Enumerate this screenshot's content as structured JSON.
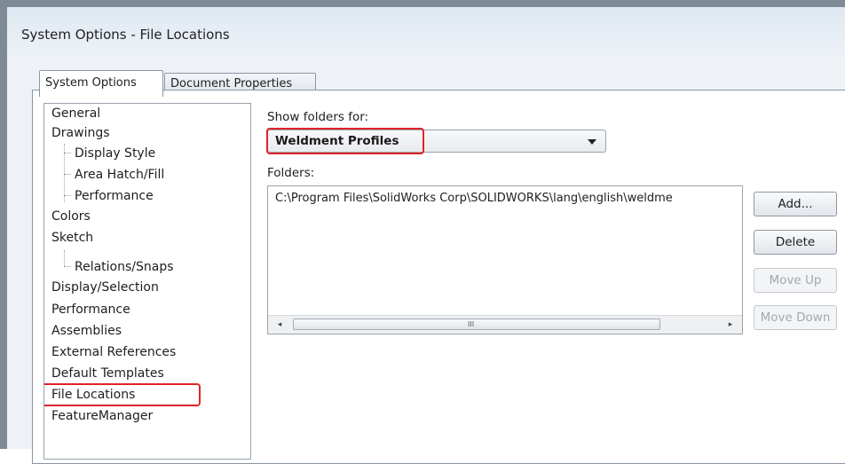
{
  "window": {
    "title": "System Options - File Locations"
  },
  "tabs": [
    {
      "label": "System Options",
      "active": true
    },
    {
      "label": "Document Properties",
      "active": false
    }
  ],
  "tree": {
    "items": [
      {
        "label": "General",
        "indent": 0
      },
      {
        "label": "Drawings",
        "indent": 0
      },
      {
        "label": "Display Style",
        "indent": 1
      },
      {
        "label": "Area Hatch/Fill",
        "indent": 1
      },
      {
        "label": "Performance",
        "indent": 1
      },
      {
        "label": "Colors",
        "indent": 0
      },
      {
        "label": "Sketch",
        "indent": 0
      },
      {
        "label": "Relations/Snaps",
        "indent": 1
      },
      {
        "label": "Display/Selection",
        "indent": 0
      },
      {
        "label": "Performance",
        "indent": 0
      },
      {
        "label": "Assemblies",
        "indent": 0
      },
      {
        "label": "External References",
        "indent": 0
      },
      {
        "label": "Default Templates",
        "indent": 0
      },
      {
        "label": "File Locations",
        "indent": 0,
        "selected": true
      },
      {
        "label": "FeatureManager",
        "indent": 0
      }
    ]
  },
  "show_folders": {
    "label": "Show folders for:",
    "value": "Weldment Profiles"
  },
  "folders": {
    "label": "Folders:",
    "rows": [
      "C:\\Program Files\\SolidWorks Corp\\SOLIDWORKS\\lang\\english\\weldme"
    ],
    "scroll_left": "◂",
    "scroll_right": "▸",
    "scroll_grip": "III"
  },
  "buttons": {
    "add": "Add...",
    "delete": "Delete",
    "move_up": "Move Up",
    "move_down": "Move Down"
  },
  "colors": {
    "highlight": "#e0232a",
    "window_border": "#7f8a97"
  }
}
